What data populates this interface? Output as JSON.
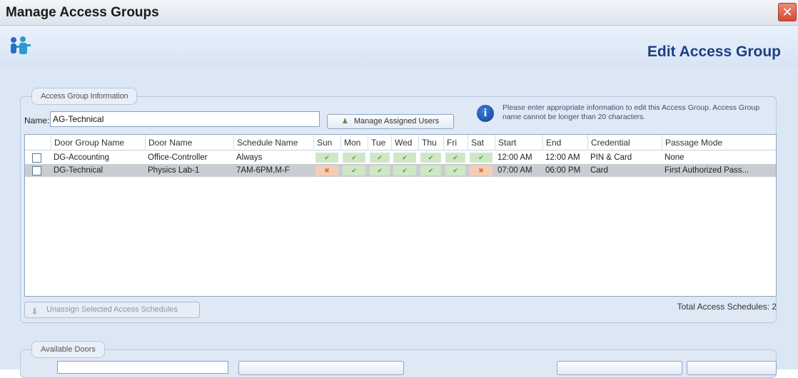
{
  "window": {
    "title": "Manage Access Groups",
    "close_label": "✕"
  },
  "header": {
    "title": "Edit Access Group",
    "icon": "users-group-icon"
  },
  "group_info": {
    "legend": "Access Group Information",
    "name_label": "Name:",
    "name_value": "AG-Technical",
    "manage_button": "Manage Assigned Users",
    "info_text": "Please enter appropriate information to edit this Access Group. Access Group name cannot be longer than 20 characters."
  },
  "grid": {
    "columns": [
      "Door Group Name",
      "Door Name",
      "Schedule Name",
      "Sun",
      "Mon",
      "Tue",
      "Wed",
      "Thu",
      "Fri",
      "Sat",
      "Start",
      "End",
      "Credential",
      "Passage Mode"
    ],
    "rows": [
      {
        "door_group": "DG-Accounting",
        "door": "Office-Controller",
        "schedule": "Always",
        "days": [
          true,
          true,
          true,
          true,
          true,
          true,
          true
        ],
        "start": "12:00 AM",
        "end": "12:00 AM",
        "credential": "PIN & Card",
        "passage": "None"
      },
      {
        "door_group": "DG-Technical",
        "door": "Physics Lab-1",
        "schedule": "7AM-6PM,M-F",
        "days": [
          false,
          true,
          true,
          true,
          true,
          true,
          false
        ],
        "start": "07:00 AM",
        "end": "06:00 PM",
        "credential": "Card",
        "passage": "First Authorized Pass..."
      }
    ]
  },
  "unassign_button": "Unassign Selected Access Schedules",
  "total_text": "Total Access Schedules: 2",
  "available_doors": {
    "legend": "Available Doors"
  },
  "colors": {
    "header_title": "#1d3f87",
    "day_yes": "#cfe7c6",
    "day_no": "#f3cdb5",
    "selected_row": "#c9cdd3"
  }
}
